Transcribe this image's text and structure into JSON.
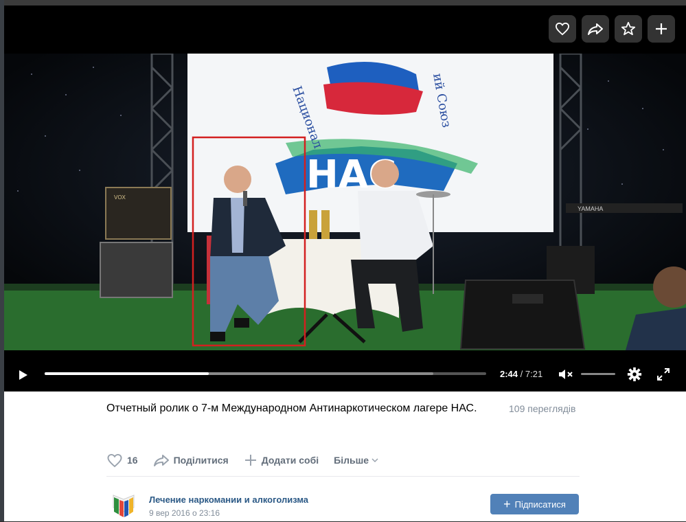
{
  "player": {
    "time_current": "2:44",
    "time_separator": "/",
    "time_total": "7:21",
    "progress": 0.372,
    "buffered": 1.0,
    "stage_sign": {
      "letters": "НАС",
      "arc_left": "Национал",
      "arc_right": "ий Союз"
    },
    "amp_brand": "VOX",
    "keyboard_brand": "YAMAHA",
    "icons": {
      "like": "heart-icon",
      "share": "share-arrow-icon",
      "favorite": "star-icon",
      "add": "plus-icon",
      "play": "play-icon",
      "mute": "volume-muted-icon",
      "settings": "gear-icon",
      "fullscreen": "fullscreen-icon"
    }
  },
  "video": {
    "title": "Отчетный ролик о 7-м Международном Антинаркотическом лагере НАС.",
    "views": "109 переглядів"
  },
  "actions": {
    "likes_count": "16",
    "share_label": "Поділитися",
    "add_label": "Додати собі",
    "more_label": "Більше"
  },
  "channel": {
    "name": "Лечение наркомании и алкоголизма",
    "date": "9 вер 2016 о 23:16",
    "subscribe_label": "Підписатися"
  },
  "colors": {
    "accent": "#5181b8",
    "link": "#2a5885",
    "muted": "#818c99",
    "highlight_box": "#d32020"
  }
}
